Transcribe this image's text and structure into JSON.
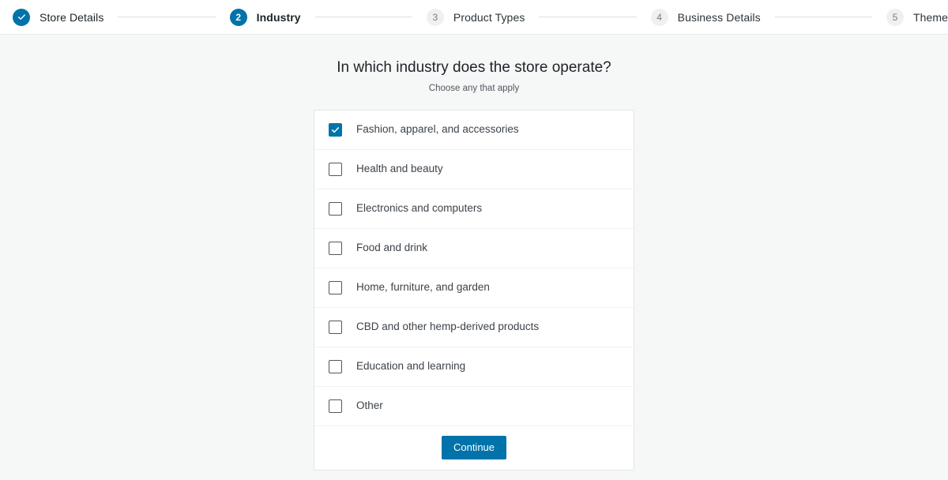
{
  "header": {
    "steps": [
      {
        "label": "Store Details",
        "number": "1",
        "state": "done",
        "icon": "check-icon"
      },
      {
        "label": "Industry",
        "number": "2",
        "state": "active",
        "icon": ""
      },
      {
        "label": "Product Types",
        "number": "3",
        "state": "pending",
        "icon": ""
      },
      {
        "label": "Business Details",
        "number": "4",
        "state": "pending",
        "icon": ""
      },
      {
        "label": "Theme",
        "number": "5",
        "state": "pending",
        "icon": ""
      }
    ]
  },
  "main": {
    "title": "In which industry does the store operate?",
    "subtitle": "Choose any that apply",
    "options": [
      {
        "label": "Fashion, apparel, and accessories",
        "checked": true
      },
      {
        "label": "Health and beauty",
        "checked": false
      },
      {
        "label": "Electronics and computers",
        "checked": false
      },
      {
        "label": "Food and drink",
        "checked": false
      },
      {
        "label": "Home, furniture, and garden",
        "checked": false
      },
      {
        "label": "CBD and other hemp-derived products",
        "checked": false
      },
      {
        "label": "Education and learning",
        "checked": false
      },
      {
        "label": "Other",
        "checked": false
      }
    ],
    "continue_label": "Continue"
  },
  "colors": {
    "accent": "#0073aa",
    "page_background": "#f6f7f7",
    "card_background": "#ffffff",
    "text": "#1d2327",
    "muted_text": "#50575e",
    "pending_bullet": "#f0f0f0"
  }
}
